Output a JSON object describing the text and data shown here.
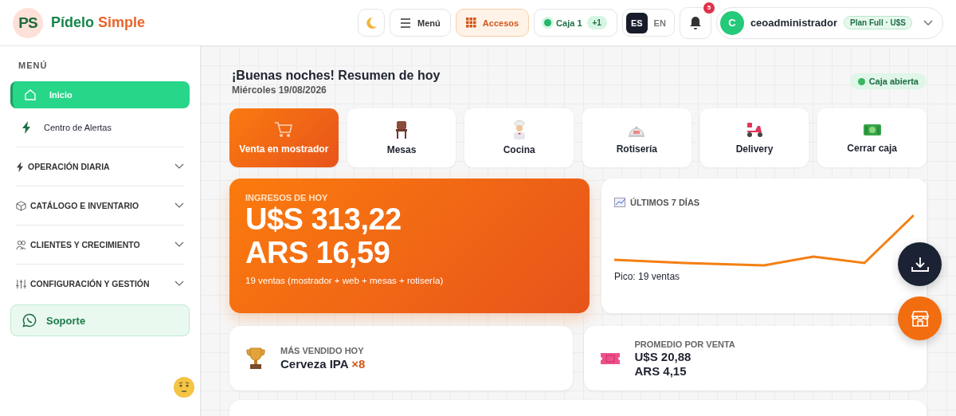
{
  "brand": {
    "logo": "PS",
    "name_first": "Pídelo",
    "name_second": "Simple"
  },
  "header": {
    "menu_label": "Menú",
    "shortcuts_label": "Accesos",
    "register": {
      "label": "Caja 1",
      "badge": "+1"
    },
    "languages": [
      {
        "label": "ES",
        "selected": true
      },
      {
        "label": "EN",
        "selected": false
      }
    ],
    "notifications": "5",
    "user": {
      "initial": "C",
      "name": "ceoadministrador",
      "plan": "Plan Full · U$S"
    }
  },
  "sidebar": {
    "heading": "MENÚ",
    "items": [
      {
        "label": "Inicio",
        "selected": true
      },
      {
        "label": "Centro de Alertas",
        "selected": false
      }
    ],
    "sections": [
      {
        "label": "OPERACIÓN DIARIA",
        "expanded": false
      },
      {
        "label": "CATÁLOGO E INVENTARIO",
        "expanded": false
      },
      {
        "label": "CLIENTES Y CRECIMIENTO",
        "expanded": false
      },
      {
        "label": "CONFIGURACIÓN Y GESTIÓN",
        "expanded": false
      }
    ],
    "support": "Soporte"
  },
  "greeting": {
    "title": "¡Buenas noches! Resumen de hoy",
    "date": "Miércoles 19/08/2026",
    "status": "Caja abierta"
  },
  "quick_actions": [
    {
      "label": "Venta en mostrador",
      "selected": true
    },
    {
      "label": "Mesas",
      "selected": false
    },
    {
      "label": "Cocina",
      "selected": false
    },
    {
      "label": "Rotisería",
      "selected": false
    },
    {
      "label": "Delivery",
      "selected": false
    },
    {
      "label": "Cerrar caja",
      "selected": false
    }
  ],
  "income": {
    "title": "INGRESOS DE HOY",
    "usd": "U$S 313,22",
    "ars": "ARS 16,59",
    "note": "19 ventas (mostrador + web + mesas + rotisería)"
  },
  "trend": {
    "title": "ÚLTIMOS 7 DÍAS",
    "peak": "Pico: 19 ventas"
  },
  "best_seller": {
    "title": "MÁS VENDIDO HOY",
    "product": "Cerveza IPA",
    "qty": "×8"
  },
  "average": {
    "title": "PROMEDIO POR VENTA",
    "usd": "U$S 20,88",
    "ars": "ARS 4,15"
  }
}
